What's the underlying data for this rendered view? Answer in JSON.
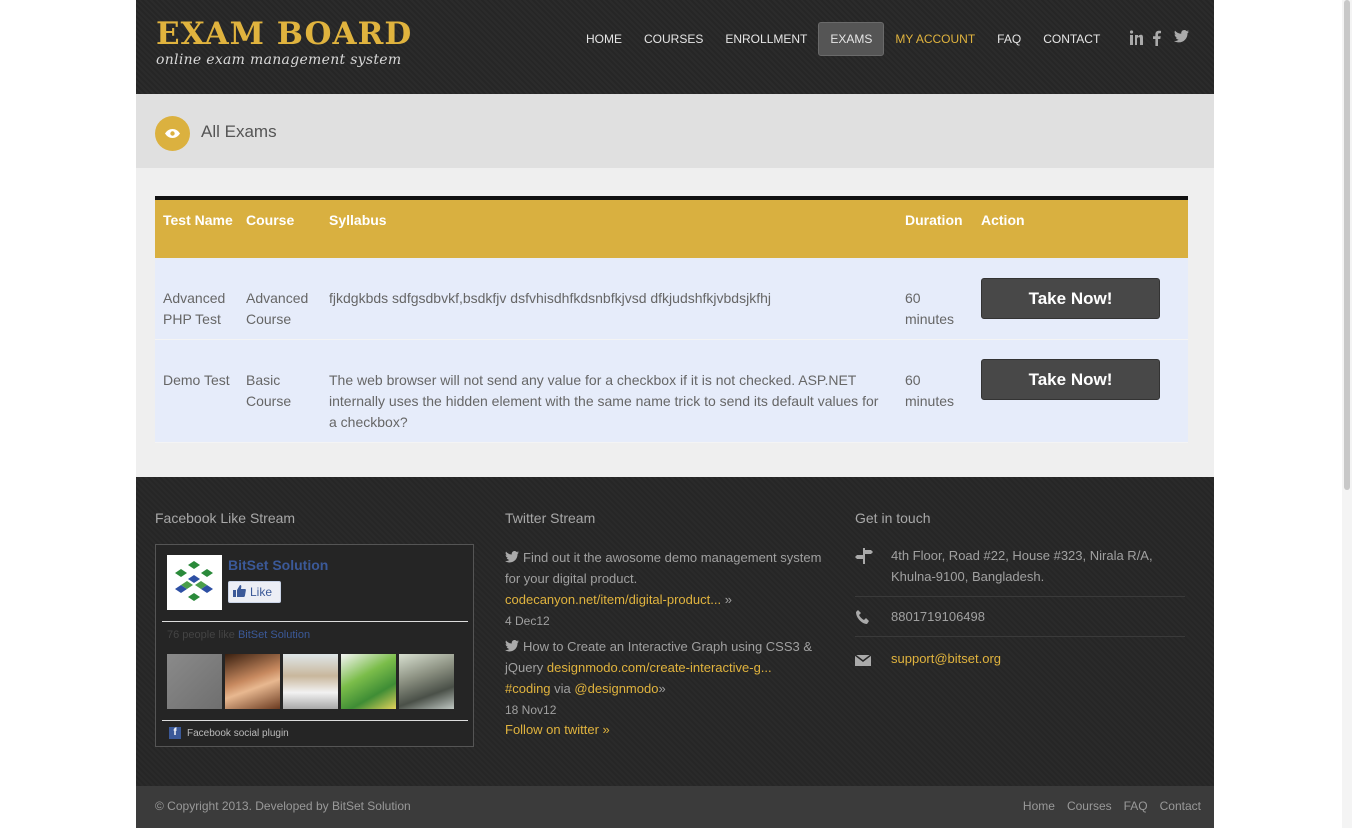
{
  "header": {
    "logo_title": "EXAM BOARD",
    "logo_subtitle": "online exam management system",
    "nav": [
      "HOME",
      "COURSES",
      "ENROLLMENT",
      "EXAMS",
      "MY ACCOUNT",
      "FAQ",
      "CONTACT"
    ],
    "active_nav": "EXAMS",
    "social": [
      "linkedin-icon",
      "facebook-icon",
      "twitter-icon"
    ]
  },
  "page": {
    "title": "All Exams"
  },
  "table": {
    "headers": {
      "test": "Test Name",
      "course": "Course",
      "syllabus": "Syllabus",
      "duration": "Duration",
      "action": "Action"
    },
    "rows": [
      {
        "test": "Advanced PHP Test",
        "course": "Advanced Course",
        "syllabus": "fjkdgkbds sdfgsdbvkf,bsdkfjv dsfvhisdhfkdsnbfkjvsd dfkjudshfkjvbdsjkfhj",
        "duration": "60 minutes",
        "action": "Take Now!"
      },
      {
        "test": "Demo Test",
        "course": "Basic Course",
        "syllabus": "The web browser will not send any value for a checkbox if it is not checked. ASP.NET internally uses the hidden element with the same name trick to send its default values for a checkbox?",
        "duration": "60 minutes",
        "action": "Take Now!"
      }
    ]
  },
  "footer": {
    "facebook": {
      "heading": "Facebook Like Stream",
      "page_name": "BitSet Solution",
      "like_label": "Like",
      "count_text": "76 people like",
      "count_link": "BitSet Solution",
      "plugin_label": "Facebook social plugin"
    },
    "twitter": {
      "heading": "Twitter Stream",
      "tweets": [
        {
          "text": "Find out it the awosome demo management system for your digital product.",
          "link": "codecanyon.net/item/digital-product...",
          "date": "4 Dec12"
        },
        {
          "text": "How to Create an Interactive Graph using CSS3 & jQuery",
          "link": "designmodo.com/create-interactive-g...",
          "hashtag": "#coding",
          "via": "via",
          "handle": "@designmodo",
          "date": "18 Nov12"
        }
      ],
      "follow": "Follow on twitter »"
    },
    "contact": {
      "heading": "Get in touch",
      "address": "4th Floor, Road #22, House #323, Nirala R/A, Khulna-9100, Bangladesh.",
      "phone": "8801719106498",
      "email": "support@bitset.org"
    },
    "copyright": "© Copyright 2013. Developed by BitSet Solution",
    "bottom_nav": [
      "Home",
      "Courses",
      "FAQ",
      "Contact"
    ]
  },
  "colors": {
    "accent": "#d9b040",
    "dark": "#262626",
    "row_bg": "#e6ecfa",
    "button": "#484848"
  }
}
